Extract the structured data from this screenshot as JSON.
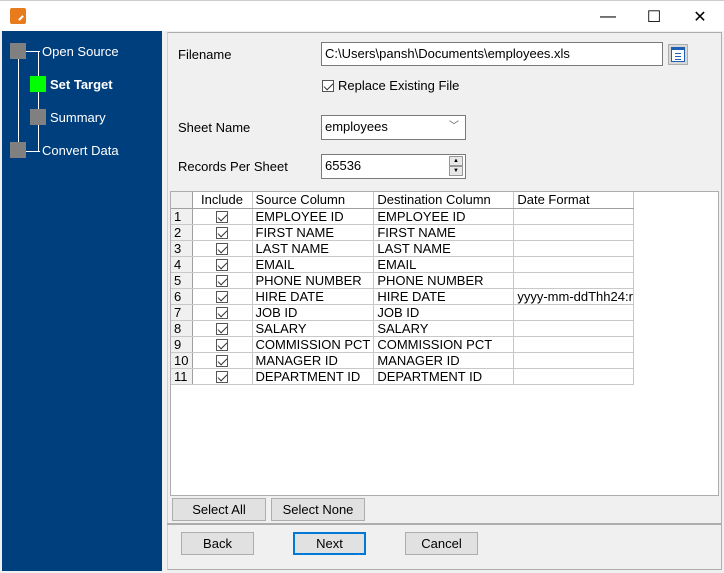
{
  "window": {
    "title": "",
    "minimize": "—",
    "maximize": "☐",
    "close": "✕",
    "app_icon": "database-edit-icon"
  },
  "wizard_steps": [
    {
      "label": "Open Source",
      "state": "done"
    },
    {
      "label": "Set Target",
      "state": "current"
    },
    {
      "label": "Summary",
      "state": "pending"
    },
    {
      "label": "Convert Data",
      "state": "pending"
    }
  ],
  "colors": {
    "sidebar": "#003f7d",
    "current_step": "#00ff00",
    "pending_step": "#808080",
    "focus": "#0078d7"
  },
  "form": {
    "filename_label": "Filename",
    "filename_value": "C:\\Users\\pansh\\Documents\\employees.xls",
    "replace_label": "Replace Existing File",
    "replace_checked": true,
    "sheet_name_label": "Sheet Name",
    "sheet_name_value": "employees",
    "records_label": "Records Per Sheet",
    "records_value": "65536"
  },
  "table": {
    "headers": [
      "",
      "Include",
      "Source Column",
      "Destination Column",
      "Date Format"
    ],
    "rows": [
      {
        "n": "1",
        "source": "EMPLOYEE ID",
        "dest": "EMPLOYEE ID",
        "fmt": ""
      },
      {
        "n": "2",
        "source": "FIRST NAME",
        "dest": "FIRST NAME",
        "fmt": ""
      },
      {
        "n": "3",
        "source": "LAST NAME",
        "dest": "LAST NAME",
        "fmt": ""
      },
      {
        "n": "4",
        "source": "EMAIL",
        "dest": "EMAIL",
        "fmt": ""
      },
      {
        "n": "5",
        "source": "PHONE NUMBER",
        "dest": "PHONE NUMBER",
        "fmt": ""
      },
      {
        "n": "6",
        "source": "HIRE DATE",
        "dest": "HIRE DATE",
        "fmt": "yyyy-mm-ddThh24:r"
      },
      {
        "n": "7",
        "source": "JOB ID",
        "dest": "JOB ID",
        "fmt": ""
      },
      {
        "n": "8",
        "source": "SALARY",
        "dest": "SALARY",
        "fmt": ""
      },
      {
        "n": "9",
        "source": "COMMISSION PCT",
        "dest": "COMMISSION PCT",
        "fmt": ""
      },
      {
        "n": "10",
        "source": "MANAGER ID",
        "dest": "MANAGER ID",
        "fmt": ""
      },
      {
        "n": "11",
        "source": "DEPARTMENT ID",
        "dest": "DEPARTMENT ID",
        "fmt": ""
      }
    ]
  },
  "buttons": {
    "select_all": "Select All",
    "select_none": "Select None",
    "back": "Back",
    "next": "Next",
    "cancel": "Cancel"
  }
}
